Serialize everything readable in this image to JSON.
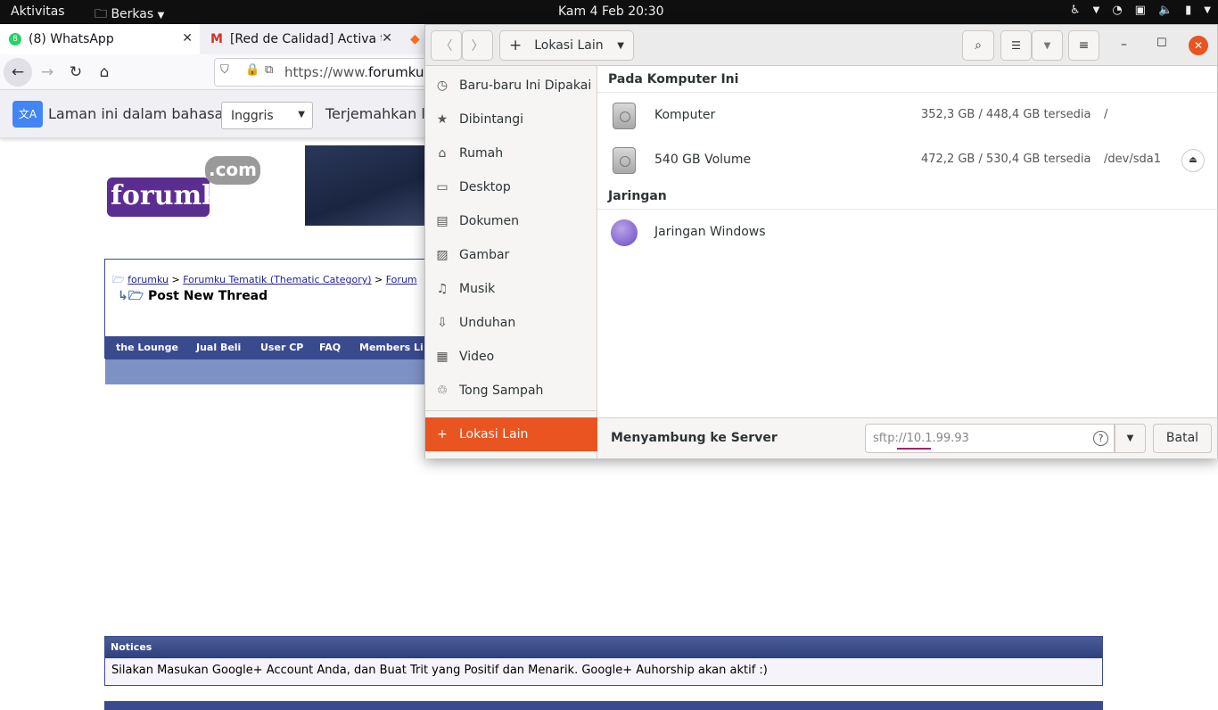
{
  "topbar": {
    "activities": "Aktivitas",
    "app": "Berkas",
    "clock": "Kam  4 Feb  20:30"
  },
  "browser": {
    "tabs": [
      {
        "label": "(8) WhatsApp"
      },
      {
        "label": "[Red de Calidad] Activa t"
      }
    ],
    "url_prefix": "https://www.",
    "url_host": "forumku.",
    "translate": {
      "prompt": "Laman ini dalam bahasa",
      "language": "Inggris",
      "action": "Terjemahkan la"
    }
  },
  "webpage": {
    "logo_text": "forumku",
    "logo_com": ".com",
    "breadcrumb": [
      "forumku",
      "Forumku Tematik (Thematic Category)",
      "Forum"
    ],
    "title": "Post New Thread",
    "navlinks": [
      "the Lounge",
      "Jual Beli",
      "User CP",
      "FAQ",
      "Members Li"
    ],
    "notices_title": "Notices",
    "notices_text": "Silakan Masukan Google+ Account Anda, dan Buat Trit yang Positif dan Menarik. Google+ Auhorship akan aktif :)"
  },
  "nautilus": {
    "location": "Lokasi Lain",
    "sidebar": [
      {
        "label": "Baru-baru Ini Dipakai",
        "icon": "clock-icon"
      },
      {
        "label": "Dibintangi",
        "icon": "star-icon"
      },
      {
        "label": "Rumah",
        "icon": "home-icon"
      },
      {
        "label": "Desktop",
        "icon": "desktop-icon"
      },
      {
        "label": "Dokumen",
        "icon": "document-icon"
      },
      {
        "label": "Gambar",
        "icon": "picture-icon"
      },
      {
        "label": "Musik",
        "icon": "music-icon"
      },
      {
        "label": "Unduhan",
        "icon": "download-icon"
      },
      {
        "label": "Video",
        "icon": "video-icon"
      },
      {
        "label": "Tong Sampah",
        "icon": "trash-icon"
      }
    ],
    "other_locations": "Lokasi Lain",
    "section_computer": "Pada Komputer Ini",
    "section_network": "Jaringan",
    "drives": [
      {
        "name": "Komputer",
        "space": "352,3 GB / 448,4 GB tersedia",
        "mount": "/"
      },
      {
        "name": "540 GB Volume",
        "space": "472,2 GB / 530,4 GB tersedia",
        "mount": "/dev/sda1"
      }
    ],
    "network": [
      {
        "name": "Jaringan Windows"
      }
    ],
    "connect_label": "Menyambung ke Server",
    "server_value": "sftp://10.1.99.93",
    "cancel": "Batal",
    "accent": "#e95420"
  }
}
